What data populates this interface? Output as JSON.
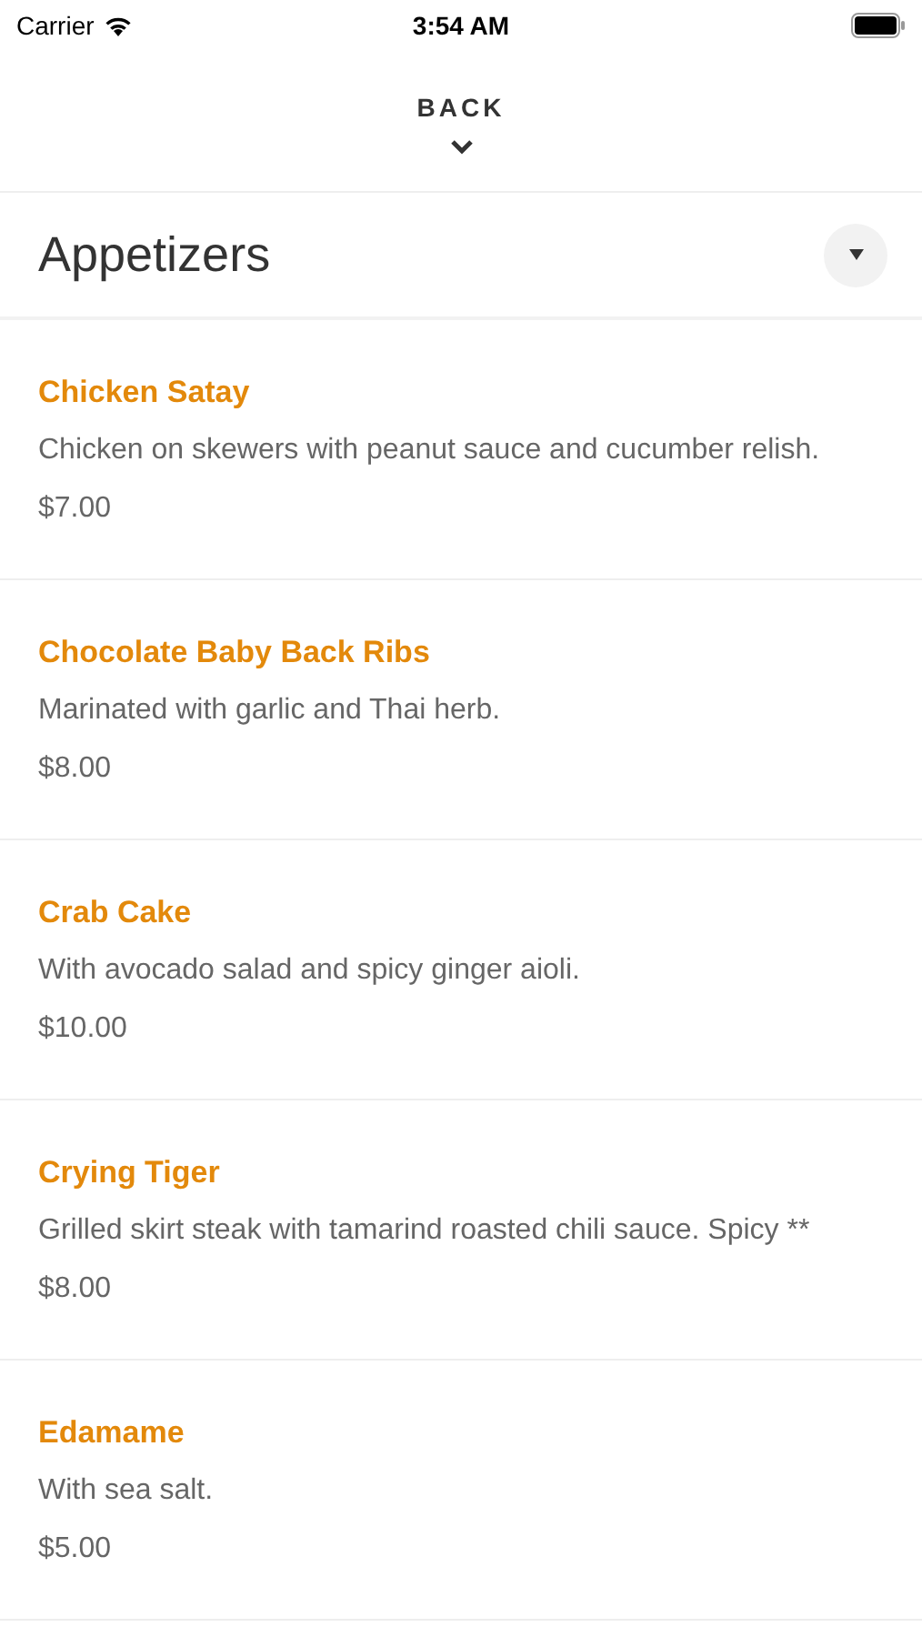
{
  "status_bar": {
    "carrier": "Carrier",
    "time": "3:54 AM"
  },
  "back": {
    "label": "BACK"
  },
  "section": {
    "title": "Appetizers",
    "expanded": true
  },
  "items": [
    {
      "name": "Chicken Satay",
      "description": "Chicken on skewers with peanut sauce and cucumber relish.",
      "price": "$7.00"
    },
    {
      "name": "Chocolate Baby Back Ribs",
      "description": "Marinated with garlic and Thai herb.",
      "price": "$8.00"
    },
    {
      "name": "Crab Cake",
      "description": "With avocado salad and spicy ginger aioli.",
      "price": "$10.00"
    },
    {
      "name": "Crying Tiger",
      "description": "Grilled skirt steak with tamarind roasted chili sauce. Spicy **",
      "price": "$8.00"
    },
    {
      "name": "Edamame",
      "description": "With sea salt.",
      "price": "$5.00"
    }
  ]
}
